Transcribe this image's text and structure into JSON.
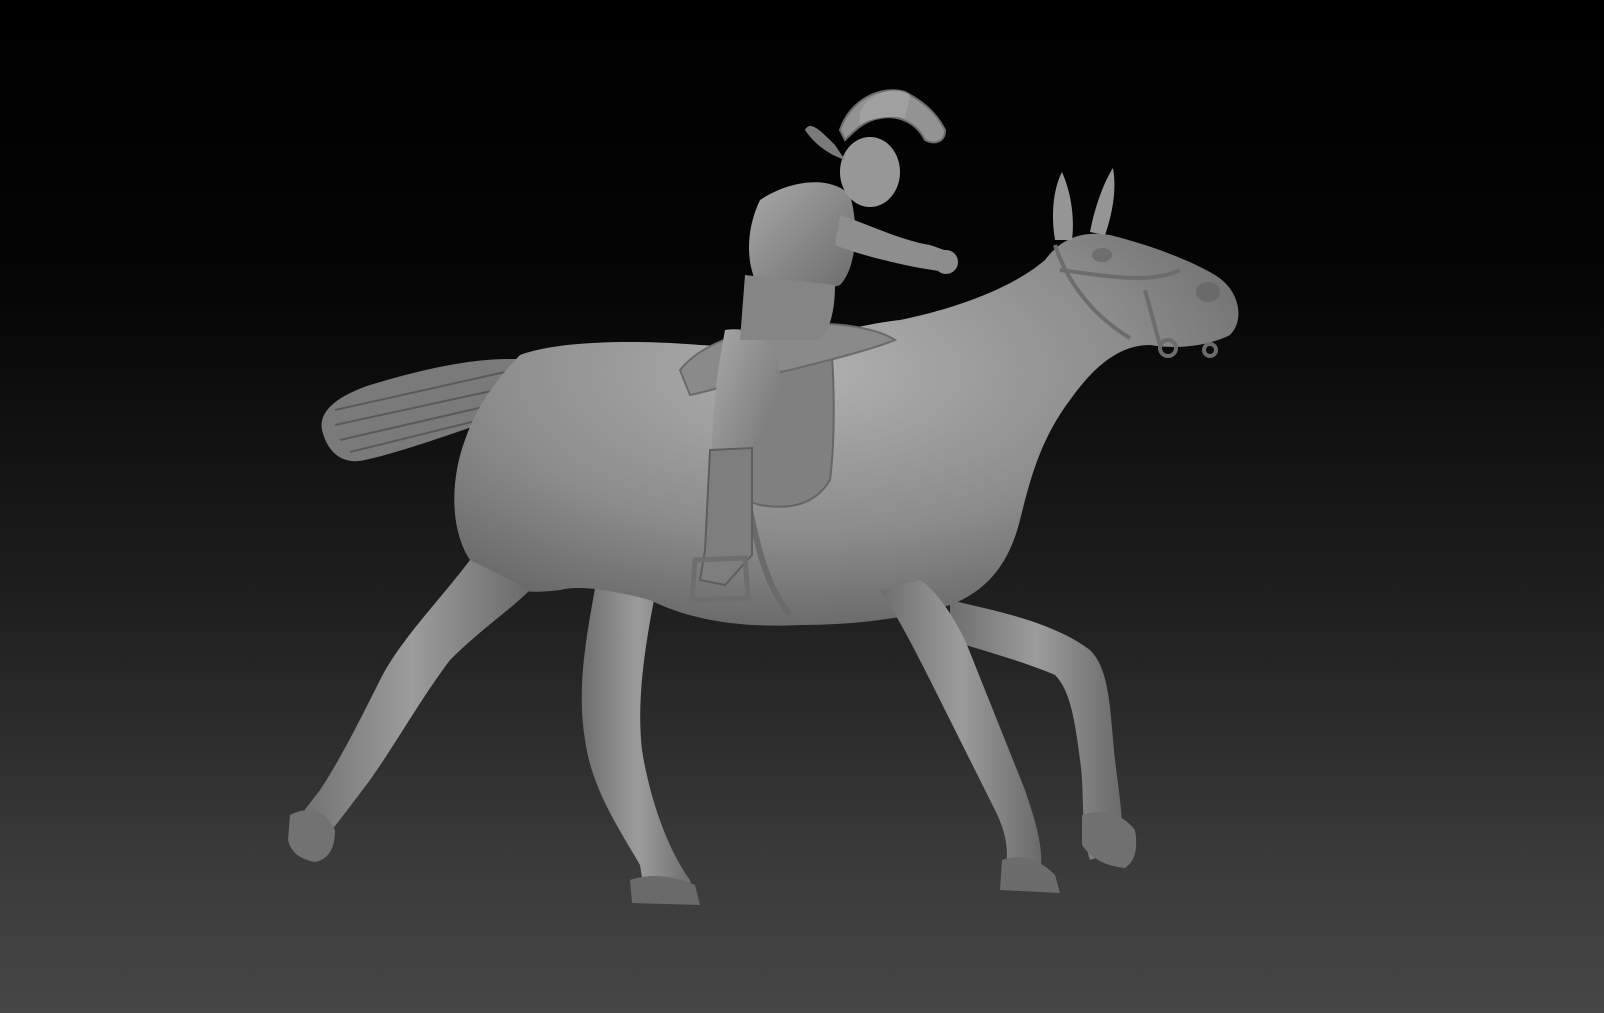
{
  "viewport": {
    "background_top": "#000000",
    "background_bottom": "#464646"
  },
  "model": {
    "material_color": "#8a8a8a",
    "highlight_color": "#b4b4b4",
    "shadow_color": "#5a5a5a"
  }
}
